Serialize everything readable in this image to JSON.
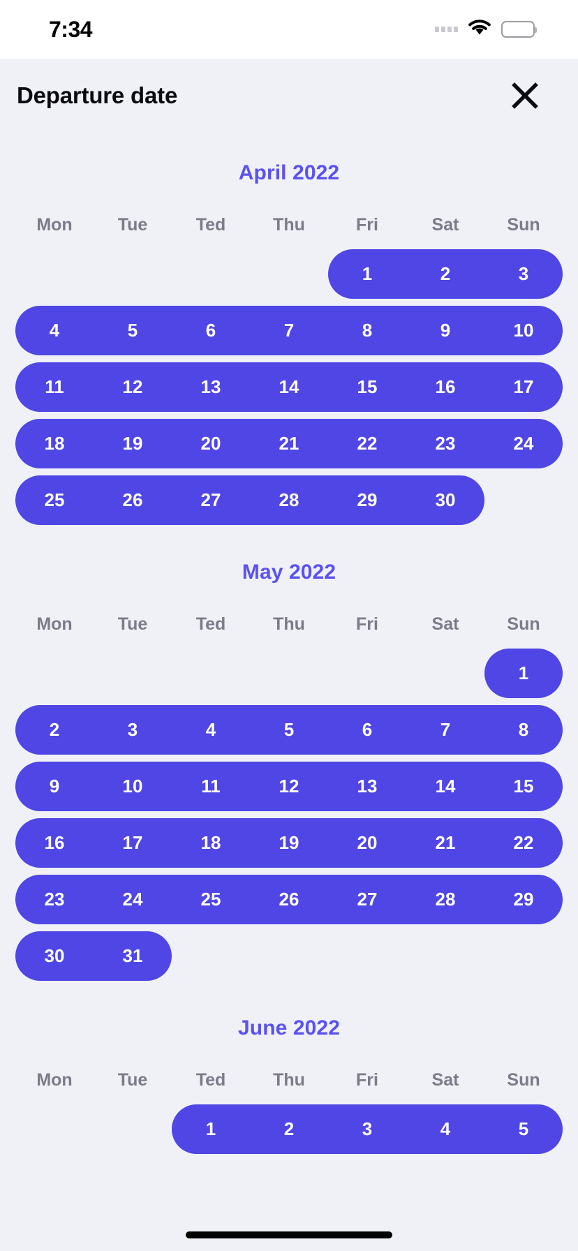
{
  "status_bar": {
    "time": "7:34",
    "signal_icon": "signal-dots-icon",
    "wifi_icon": "wifi-icon",
    "battery_icon": "battery-full-icon"
  },
  "header": {
    "title": "Departure date",
    "close_icon": "close-x-icon"
  },
  "colors": {
    "background": "#eff1f6",
    "status_bar_background": "#ffffff",
    "accent": "#4f46e5",
    "month_title": "#5b51f2",
    "weekday_label": "#7b7b8a",
    "title_text": "#0b0b0f",
    "selected_day_text": "#ffffff"
  },
  "calendar": {
    "weekdays": [
      "Mon",
      "Tue",
      "Ted",
      "Thu",
      "Fri",
      "Sat",
      "Sun"
    ],
    "months": [
      {
        "title": "April 2022",
        "weeks": [
          {
            "days": [
              "",
              "",
              "",
              "",
              "1",
              "2",
              "3"
            ],
            "selected_start": 4,
            "selected_end": 6,
            "cap_left": true,
            "cap_right": true
          },
          {
            "days": [
              "4",
              "5",
              "6",
              "7",
              "8",
              "9",
              "10"
            ],
            "selected_start": 0,
            "selected_end": 6,
            "cap_left": true,
            "cap_right": true
          },
          {
            "days": [
              "11",
              "12",
              "13",
              "14",
              "15",
              "16",
              "17"
            ],
            "selected_start": 0,
            "selected_end": 6,
            "cap_left": true,
            "cap_right": true
          },
          {
            "days": [
              "18",
              "19",
              "20",
              "21",
              "22",
              "23",
              "24"
            ],
            "selected_start": 0,
            "selected_end": 6,
            "cap_left": true,
            "cap_right": true
          },
          {
            "days": [
              "25",
              "26",
              "27",
              "28",
              "29",
              "30",
              ""
            ],
            "selected_start": 0,
            "selected_end": 5,
            "cap_left": true,
            "cap_right": true
          }
        ]
      },
      {
        "title": "May 2022",
        "weeks": [
          {
            "days": [
              "",
              "",
              "",
              "",
              "",
              "",
              "1"
            ],
            "selected_start": 6,
            "selected_end": 6,
            "cap_left": true,
            "cap_right": true
          },
          {
            "days": [
              "2",
              "3",
              "4",
              "5",
              "6",
              "7",
              "8"
            ],
            "selected_start": 0,
            "selected_end": 6,
            "cap_left": true,
            "cap_right": true
          },
          {
            "days": [
              "9",
              "10",
              "11",
              "12",
              "13",
              "14",
              "15"
            ],
            "selected_start": 0,
            "selected_end": 6,
            "cap_left": true,
            "cap_right": true
          },
          {
            "days": [
              "16",
              "17",
              "18",
              "19",
              "20",
              "21",
              "22"
            ],
            "selected_start": 0,
            "selected_end": 6,
            "cap_left": true,
            "cap_right": true
          },
          {
            "days": [
              "23",
              "24",
              "25",
              "26",
              "27",
              "28",
              "29"
            ],
            "selected_start": 0,
            "selected_end": 6,
            "cap_left": true,
            "cap_right": true
          },
          {
            "days": [
              "30",
              "31",
              "",
              "",
              "",
              "",
              ""
            ],
            "selected_start": 0,
            "selected_end": 1,
            "cap_left": true,
            "cap_right": true
          }
        ]
      },
      {
        "title": "June 2022",
        "weeks": [
          {
            "days": [
              "",
              "",
              "1",
              "2",
              "3",
              "4",
              "5"
            ],
            "selected_start": 2,
            "selected_end": 6,
            "cap_left": true,
            "cap_right": true
          }
        ]
      }
    ]
  }
}
